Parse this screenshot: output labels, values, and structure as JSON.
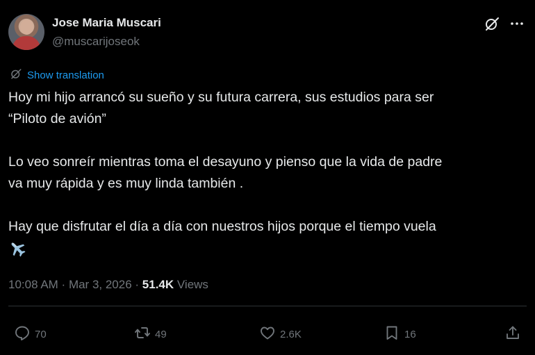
{
  "author": {
    "display_name": "Jose Maria Muscari",
    "handle": "@muscarijoseok"
  },
  "icons": {
    "top_right": [
      "grok-icon",
      "more-icon"
    ],
    "translate": "translate-icon",
    "emoji": "airplane-emoji",
    "actions": [
      "reply-icon",
      "retweet-icon",
      "like-icon",
      "bookmark-icon",
      "share-icon"
    ]
  },
  "translation": {
    "label": "Show translation"
  },
  "tweet": {
    "text_main": "Hoy mi hijo arrancó su sueño y su futura carrera, sus estudios para ser\n“Piloto de avión”\n\nLo veo sonreír mientras toma el desayuno y pienso que la vida  de padre\nva muy rápida y es muy linda también .\n\nHay que disfrutar el día a día con nuestros hijos porque el tiempo vuela\n"
  },
  "meta": {
    "time": "10:08 AM",
    "separator": " · ",
    "date": "Mar 3, 2026",
    "views_count": "51.4K",
    "views_label": " Views"
  },
  "stats": {
    "replies": "70",
    "retweets": "49",
    "likes": "2.6K",
    "bookmarks": "16"
  },
  "colors": {
    "background": "#000000",
    "text": "#e7e9ea",
    "secondary": "#71767b",
    "link": "#1d9bf0"
  }
}
